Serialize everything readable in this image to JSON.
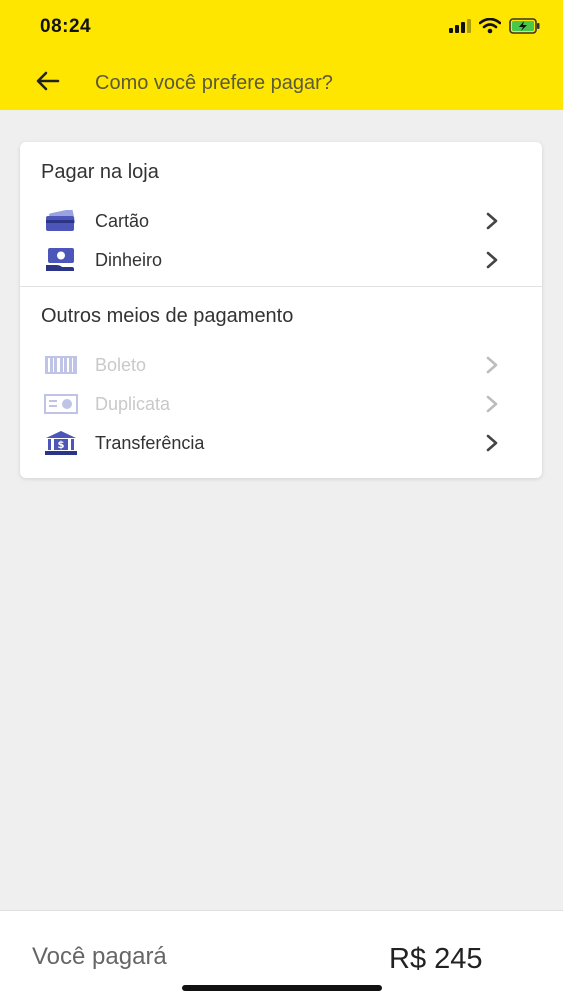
{
  "status_bar": {
    "time": "08:24",
    "signal_icon": "cellular-signal-icon",
    "wifi_icon": "wifi-icon",
    "battery_icon": "battery-charging-icon"
  },
  "header": {
    "title": "Como você prefere pagar?",
    "back_icon": "arrow-left-icon",
    "background_color": "#ffe600"
  },
  "card": {
    "store_section": {
      "title": "Pagar na loja",
      "items": [
        {
          "label": "Cartão",
          "icon": "credit-card-icon",
          "enabled": true
        },
        {
          "label": "Dinheiro",
          "icon": "cash-hand-icon",
          "enabled": true
        }
      ]
    },
    "other_section": {
      "title": "Outros meios de pagamento",
      "items": [
        {
          "label": "Boleto",
          "icon": "barcode-icon",
          "enabled": false
        },
        {
          "label": "Duplicata",
          "icon": "bill-icon",
          "enabled": false
        },
        {
          "label": "Transferência",
          "icon": "bank-icon",
          "enabled": true
        }
      ]
    }
  },
  "footer": {
    "label": "Você pagará",
    "amount": "R$ 245"
  },
  "colors": {
    "accent_icon": "#4b56b8",
    "disabled_text": "#c9c9c9"
  }
}
